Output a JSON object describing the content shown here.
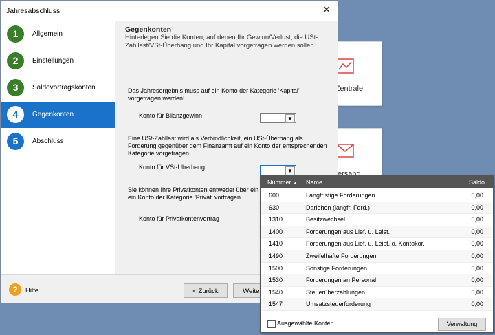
{
  "background": {
    "card1_label": "r Zentrale",
    "card2_label": "ersand"
  },
  "dialog": {
    "title": "Jahresabschluss",
    "close_glyph": "✕",
    "steps": [
      {
        "num": "1",
        "label": "Allgemein"
      },
      {
        "num": "2",
        "label": "Einstellungen"
      },
      {
        "num": "3",
        "label": "Saldovortragskonten"
      },
      {
        "num": "4",
        "label": "Gegenkonten"
      },
      {
        "num": "5",
        "label": "Abschluss"
      }
    ],
    "heading": "Gegenkonten",
    "subheading": "Hinterlegen Sie die Konten, auf denen Ihr Gewinn/Verlust, die USt-Zahllast/VSt-Überhang und Ihr Kapital vorgetragen werden sollen.",
    "para1": "Das Jahresergebnis muss auf ein Konto der Kategorie 'Kapital' vorgetragen werden!",
    "field1_label": "Konto für Bilanzgewinn",
    "para2": "Eine USt-Zahllast wird als Verbindlichkeit, ein USt-Überhang als Forderung gegenüber dem Finanzamt auf ein Konto der entsprechenden Kategorie vorgetragen.",
    "field2_label": "Konto für VSt-Überhang",
    "para3": "Sie können Ihre Privatkonten entweder über ein Kapitalkonto oder über ein Konto der Kategorie 'Privat' vortragen.",
    "field3_label": "Konto für Privatkontenvortrag",
    "help_icon": "?",
    "help_label": "Hilfe",
    "back_label": "< Zurück",
    "next_label": "Weiter >"
  },
  "popup": {
    "col_number": "Nummer",
    "col_name": "Name",
    "col_saldo": "Saldo",
    "sort_glyph": "▲",
    "rows": [
      {
        "n": "600",
        "name": "Langfristige Forderungen",
        "saldo": "0,00"
      },
      {
        "n": "630",
        "name": "Darlehen (langfr. Ford.)",
        "saldo": "0,00"
      },
      {
        "n": "1310",
        "name": "Besitzwechsel",
        "saldo": "0,00"
      },
      {
        "n": "1400",
        "name": "Forderungen aus Lief. u. Leist.",
        "saldo": "0,00"
      },
      {
        "n": "1410",
        "name": "Forderungen aus Lief. u. Leist. o. Kontokor.",
        "saldo": "0,00"
      },
      {
        "n": "1490",
        "name": "Zweifelhafte Forderungen",
        "saldo": "0,00"
      },
      {
        "n": "1500",
        "name": "Sonstige Forderungen",
        "saldo": "0,00"
      },
      {
        "n": "1530",
        "name": "Forderungen an Personal",
        "saldo": "0,00"
      },
      {
        "n": "1540",
        "name": "Steuerüberzahlungen",
        "saldo": "0,00"
      },
      {
        "n": "1547",
        "name": "Umsatzsteuerforderung",
        "saldo": "0,00"
      }
    ],
    "checkbox_label": "Ausgewählte Konten",
    "manage_label": "Verwaltung"
  },
  "colors": {
    "step_done": "#3a7d2a",
    "step_active": "#1a73c8"
  }
}
